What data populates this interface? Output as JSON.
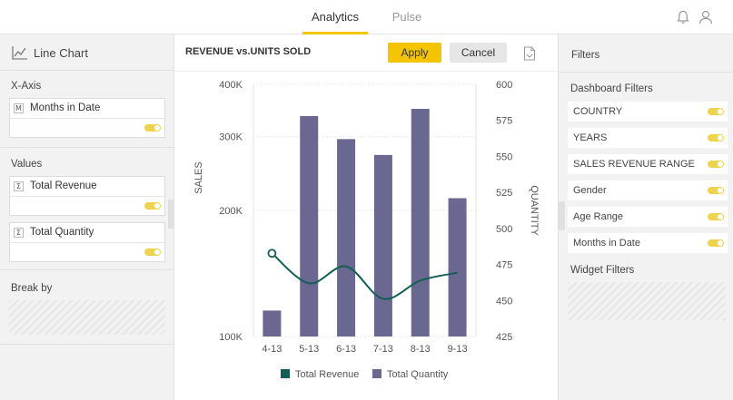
{
  "tabs": [
    {
      "label": "Analytics",
      "active": true
    },
    {
      "label": "Pulse",
      "active": false
    }
  ],
  "icons": {
    "notifications": "bell-icon",
    "user": "user-icon",
    "chart_type": "line-chart-icon",
    "export": "document-icon"
  },
  "accent_color": "#f5c400",
  "left_panel": {
    "chart_type_label": "Line Chart",
    "x_axis": {
      "label": "X-Axis",
      "field": {
        "badge": "M",
        "name": "Months in Date",
        "toggle_on": true
      }
    },
    "values": {
      "label": "Values",
      "fields": [
        {
          "badge": "Σ",
          "name": "Total Revenue",
          "toggle_on": true
        },
        {
          "badge": "Σ",
          "name": "Total Quantity",
          "toggle_on": true
        }
      ]
    },
    "break_by": {
      "label": "Break by"
    }
  },
  "toolbar": {
    "title": "REVENUE vs.UNITS SOLD",
    "apply_label": "Apply",
    "cancel_label": "Cancel"
  },
  "right_panel": {
    "title": "Filters",
    "dashboard_filters_label": "Dashboard Filters",
    "dashboard_filters": [
      {
        "label": "COUNTRY",
        "toggle_on": true
      },
      {
        "label": "YEARS",
        "toggle_on": true
      },
      {
        "label": "SALES REVENUE RANGE",
        "toggle_on": true
      },
      {
        "label": "Gender",
        "toggle_on": true
      },
      {
        "label": "Age Range",
        "toggle_on": true
      },
      {
        "label": "Months in Date",
        "toggle_on": true
      }
    ],
    "widget_filters_label": "Widget Filters"
  },
  "chart_data": {
    "type": "bar",
    "categories": [
      "4-13",
      "5-13",
      "6-13",
      "7-13",
      "8-13",
      "9-13"
    ],
    "ylabel_left": "SALES",
    "ylabel_right": "QUANTITY",
    "left_axis": {
      "scale": "log",
      "range": [
        100000,
        400000
      ],
      "ticks": [
        100000,
        200000,
        300000,
        400000
      ],
      "tick_labels": [
        "100K",
        "200K",
        "300K",
        "400K"
      ]
    },
    "right_axis": {
      "scale": "linear",
      "range": [
        425,
        600
      ],
      "ticks": [
        425,
        450,
        475,
        500,
        525,
        550,
        575,
        600
      ],
      "tick_labels": [
        "425",
        "450",
        "475",
        "500",
        "525",
        "550",
        "575",
        "600"
      ]
    },
    "series": [
      {
        "name": "Total Revenue",
        "type": "line",
        "axis": "left",
        "color": "#125e55",
        "values": [
          158000,
          134000,
          147000,
          123000,
          136000,
          142000
        ]
      },
      {
        "name": "Total Quantity",
        "type": "bar",
        "axis": "right",
        "color": "#6a6890",
        "values": [
          443,
          578,
          562,
          551,
          583,
          521
        ]
      }
    ],
    "grid": true,
    "legend_position": "bottom"
  }
}
